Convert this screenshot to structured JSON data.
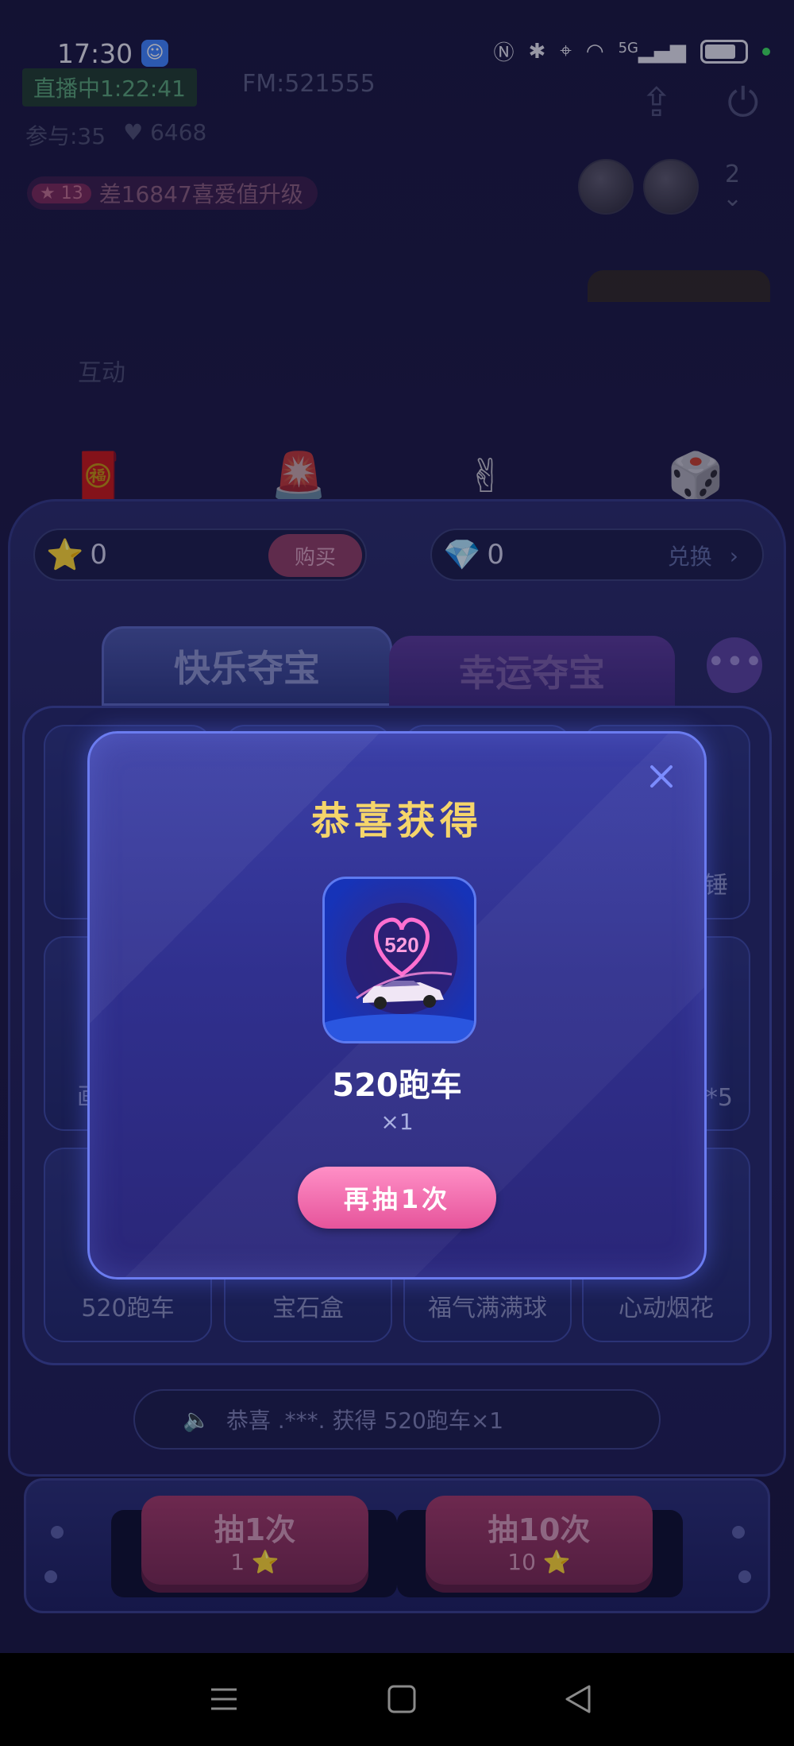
{
  "status_bar": {
    "time": "17:30",
    "signal_label": "5G"
  },
  "live": {
    "badge": "直播中1:22:41",
    "fm": "FM:521555",
    "participants": "参与:35",
    "likes": "6468",
    "level": "13",
    "level_text": "差16847喜爱值升级",
    "avatar_rank": "2",
    "viewer_count": "2",
    "interaction_label": "互动"
  },
  "game": {
    "stars": "0",
    "buy_label": "购买",
    "gems": "0",
    "exchange_label": "兑换",
    "tabs": [
      {
        "label": "快乐夺宝"
      },
      {
        "label": "幸运夺宝"
      }
    ],
    "prizes_row3": [
      {
        "name": "520跑车"
      },
      {
        "name": "宝石盒"
      },
      {
        "name": "福气满满球"
      },
      {
        "name": "心动烟花"
      }
    ],
    "partial_labels": {
      "right_row1": "锤",
      "right_row2": "*5",
      "left_row2": "画"
    },
    "broadcast": "恭喜 .***. 获得 520跑车×1",
    "draw_buttons": [
      {
        "label": "抽1次",
        "cost": "1"
      },
      {
        "label": "抽10次",
        "cost": "10"
      }
    ]
  },
  "modal": {
    "title": "恭喜获得",
    "prize_name": "520跑车",
    "prize_image_text": "520",
    "quantity": "×1",
    "again_label": "再抽1次"
  },
  "colors": {
    "modal_title": "#f5d56a",
    "again_button": "#e6549b",
    "modal_border": "#6b7cf0"
  }
}
